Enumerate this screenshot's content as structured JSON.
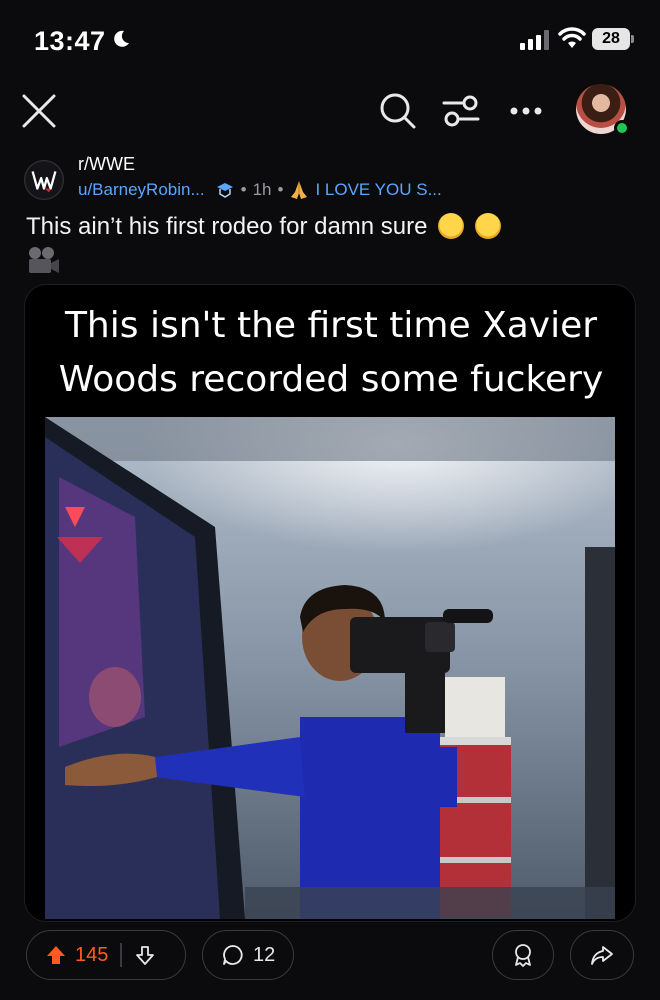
{
  "status_bar": {
    "time": "13:47",
    "battery": "28"
  },
  "toolbar": {
    "close_icon": "close-icon",
    "search_icon": "search-icon",
    "filter_icon": "filter-icon",
    "more_icon": "more-icon",
    "online_color": "#23c552"
  },
  "post": {
    "subreddit": "r/WWE",
    "username": "u/BarneyRobin...",
    "separator": "•",
    "age": "1h",
    "flair": "I LOVE YOU S...",
    "title": "This ain’t his first rodeo for damn sure",
    "media_caption_line1": "This isn't the first time Xavier",
    "media_caption_line2": "Woods recorded some fuckery"
  },
  "actions": {
    "upvotes": "145",
    "comments": "12",
    "upvote_color": "#ff5a1f"
  }
}
